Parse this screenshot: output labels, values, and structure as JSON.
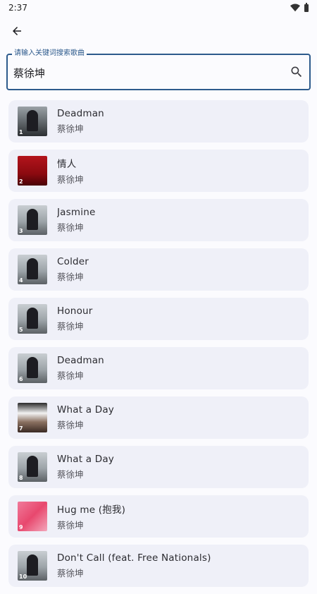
{
  "status_bar": {
    "time": "2:37",
    "icons": [
      "wifi-icon",
      "battery-icon"
    ]
  },
  "header": {
    "back_icon": "arrow-left-icon"
  },
  "search": {
    "label": "请输入关键词搜索歌曲",
    "value": "蔡徐坤",
    "icon": "search-icon",
    "accent_color": "#2d5a8c"
  },
  "songs": [
    {
      "rank": "1",
      "title": "Deadman",
      "artist": "蔡徐坤",
      "cover": "dark-gray"
    },
    {
      "rank": "2",
      "title": "情人",
      "artist": "蔡徐坤",
      "cover": "red"
    },
    {
      "rank": "3",
      "title": "Jasmine",
      "artist": "蔡徐坤",
      "cover": "gray"
    },
    {
      "rank": "4",
      "title": "Colder",
      "artist": "蔡徐坤",
      "cover": "gray"
    },
    {
      "rank": "5",
      "title": "Honour",
      "artist": "蔡徐坤",
      "cover": "gray"
    },
    {
      "rank": "6",
      "title": "Deadman",
      "artist": "蔡徐坤",
      "cover": "gray"
    },
    {
      "rank": "7",
      "title": "What a Day",
      "artist": "蔡徐坤",
      "cover": "photo"
    },
    {
      "rank": "8",
      "title": "What a Day",
      "artist": "蔡徐坤",
      "cover": "gray"
    },
    {
      "rank": "9",
      "title": "Hug me (抱我)",
      "artist": "蔡徐坤",
      "cover": "pink"
    },
    {
      "rank": "10",
      "title": "Don't Call (feat. Free Nationals)",
      "artist": "蔡徐坤",
      "cover": "gray"
    }
  ]
}
